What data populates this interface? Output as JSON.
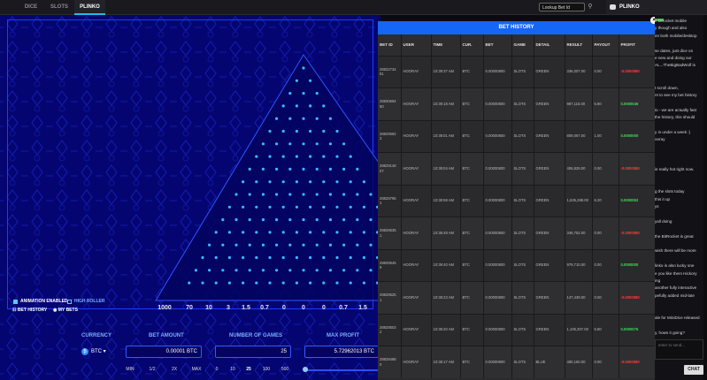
{
  "nav": {
    "tabs": [
      {
        "label": "DICE"
      },
      {
        "label": "SLOTS"
      },
      {
        "label": "PLINKO"
      }
    ],
    "active_tab": "PLINKO",
    "lookup_placeholder": "Lookup Bet Id",
    "lookup_icon": "search-icon"
  },
  "chat_header": {
    "title": "PLINKO",
    "icon": "chat-bubble-icon"
  },
  "game": {
    "options": {
      "animation_label": "ANIMATION ENABLED",
      "animation_on": true,
      "high_roller_label": "HIGH ROLLER",
      "high_roller_on": false
    },
    "bottom_tabs": {
      "bet_history": "BET HISTORY",
      "my_bets": "MY BETS"
    },
    "multipliers": [
      "1000",
      "70",
      "10",
      "3",
      "1.5",
      "0.7",
      "0",
      "0",
      "0",
      "0.7",
      "1.5"
    ],
    "currency_label": "CURRENCY",
    "currency_value": "BTC",
    "bet_amount_label": "BET AMOUNT",
    "bet_amount_value": "0.00001 BTC",
    "num_games_label": "NUMBER OF GAMES",
    "num_games_value": "25",
    "max_profit_label": "MAX PROFIT",
    "max_profit_value": "5.72962013 BTC",
    "bet_quick": [
      "MIN",
      "1/2",
      "2X",
      "MAX"
    ],
    "games_quick": [
      "0",
      "10",
      "25",
      "100",
      "500"
    ],
    "colors": {
      "background": "#050572",
      "accent": "#2bb6f0",
      "peg": "#39b8ff"
    }
  },
  "history": {
    "title": "BET HISTORY",
    "columns": [
      "BET ID",
      "USER",
      "TIME",
      "CUR.",
      "BET",
      "GAME",
      "DETAIL",
      "RESULT",
      "PAYOUT",
      "PROFIT"
    ],
    "rows": [
      [
        "28832734 81",
        "HOORAY",
        "10:39:37 AM",
        "BTC",
        "0.00000800",
        "SLOTS",
        "GREEN",
        "336,007.00",
        "0.00",
        "-0.0000080"
      ],
      [
        "28830694 50",
        "HOORAY",
        "10:39:18 AM",
        "BTC",
        "0.00000800",
        "SLOTS",
        "GREEN",
        "987,115.00",
        "5.80",
        "0.0000046"
      ],
      [
        "28829562 3",
        "HOORAY",
        "10:39:01 AM",
        "BTC",
        "0.00000800",
        "SLOTS",
        "GREEN",
        "809,067.00",
        "1.00",
        "0.0000000"
      ],
      [
        "28829148 07",
        "HOORAY",
        "10:39:04 AM",
        "BTC",
        "0.00000800",
        "SLOTS",
        "GREEN",
        "406,829.00",
        "0.00",
        "-0.0000080"
      ],
      [
        "28828795 1",
        "HOORAY",
        "10:38:58 AM",
        "BTC",
        "0.00000800",
        "SLOTS",
        "GREEN",
        "1,635,288.00",
        "6.20",
        "0.0000052"
      ],
      [
        "28828535 1",
        "HOORAY",
        "10:38:48 AM",
        "BTC",
        "0.00000800",
        "SLOTS",
        "GREEN",
        "346,752.00",
        "0.00",
        "-0.0000080"
      ],
      [
        "28828545 9",
        "HOORAY",
        "10:39:40 AM",
        "BTC",
        "0.00000800",
        "SLOTS",
        "GREEN",
        "979,710.00",
        "0.00",
        "0.0000000"
      ],
      [
        "28828525 1",
        "HOORAY",
        "10:38:23 AM",
        "BTC",
        "0.00000800",
        "SLOTS",
        "GREEN",
        "147,439.00",
        "0.00",
        "-0.0000080"
      ],
      [
        "28828503 2",
        "HOORAY",
        "10:38:20 AM",
        "BTC",
        "0.00000800",
        "SLOTS",
        "GREEN",
        "1,105,307.00",
        "5.80",
        "0.0000075"
      ],
      [
        "28828488 0",
        "HOORAY",
        "10:38:17 AM",
        "BTC",
        "0.00000800",
        "SLOTS",
        "BLUE",
        "480,160.00",
        "0.00",
        "-0.0000080"
      ]
    ]
  },
  "chat": {
    "messages": [
      "e bitrocket mobile",
      "y though and also",
      "en both mobile/desktop",
      "",
      "se dates, just dice on",
      "e new and doing our",
      "AL...TheBigBadWolf is",
      "",
      "",
      "t scroll down,",
      "nt to see my bet history",
      "",
      "io - we are actually fast",
      "the history, this should",
      "",
      "y in under a week :)",
      "ooray",
      "",
      "",
      "",
      "is really hot right now.",
      "",
      "",
      "g the slots today",
      "this it up",
      "ys",
      "",
      "yall doing",
      "",
      "the BitRocket is great",
      "",
      "wish there will be more",
      "",
      "linko is also lucky one",
      "e you like them Hickory",
      "ing",
      "another fully interactive",
      "pefully added mid-late",
      "",
      "",
      "ale for MiniDice released",
      "",
      "y, hows it going?"
    ],
    "input_placeholder": "enter to send...",
    "send_label": "CHAT"
  }
}
